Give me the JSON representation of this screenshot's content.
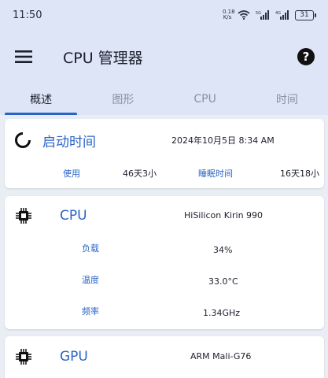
{
  "status_bar": {
    "time": "11:50",
    "net_speed_top": "0.18",
    "net_speed_bottom": "K/s",
    "battery": "31",
    "icons": [
      "wifi-icon",
      "signal-5g-icon",
      "signal-icon"
    ]
  },
  "app_bar": {
    "title": "CPU 管理器",
    "menu_icon": "hamburger-menu-icon",
    "help_icon": "help-circle-icon"
  },
  "tabs": [
    {
      "label": "概述",
      "active": true
    },
    {
      "label": "图形",
      "active": false
    },
    {
      "label": "CPU",
      "active": false
    },
    {
      "label": "时间",
      "active": false
    }
  ],
  "uptime_card": {
    "icon": "uptime-ring-icon",
    "title": "启动时间",
    "boot_datetime": "2024年10月5日 8:34 AM",
    "used_label": "使用",
    "used_value": "46天3小",
    "sleep_label": "睡眠时间",
    "sleep_value": "16天18小"
  },
  "cpu_card": {
    "icon": "chip-icon",
    "title": "CPU",
    "model": "HiSilicon Kirin 990",
    "load_label": "负载",
    "load_value": "34%",
    "temp_label": "温度",
    "temp_value": "33.0°C",
    "freq_label": "频率",
    "freq_value": "1.34GHz"
  },
  "gpu_card": {
    "icon": "chip-icon",
    "title": "GPU",
    "model": "ARM Mali-G76"
  },
  "colors": {
    "accent": "#2a64c8",
    "app_bar_bg": "#dde5f7",
    "page_bg": "#e9edf4",
    "card_bg": "#ffffff"
  }
}
